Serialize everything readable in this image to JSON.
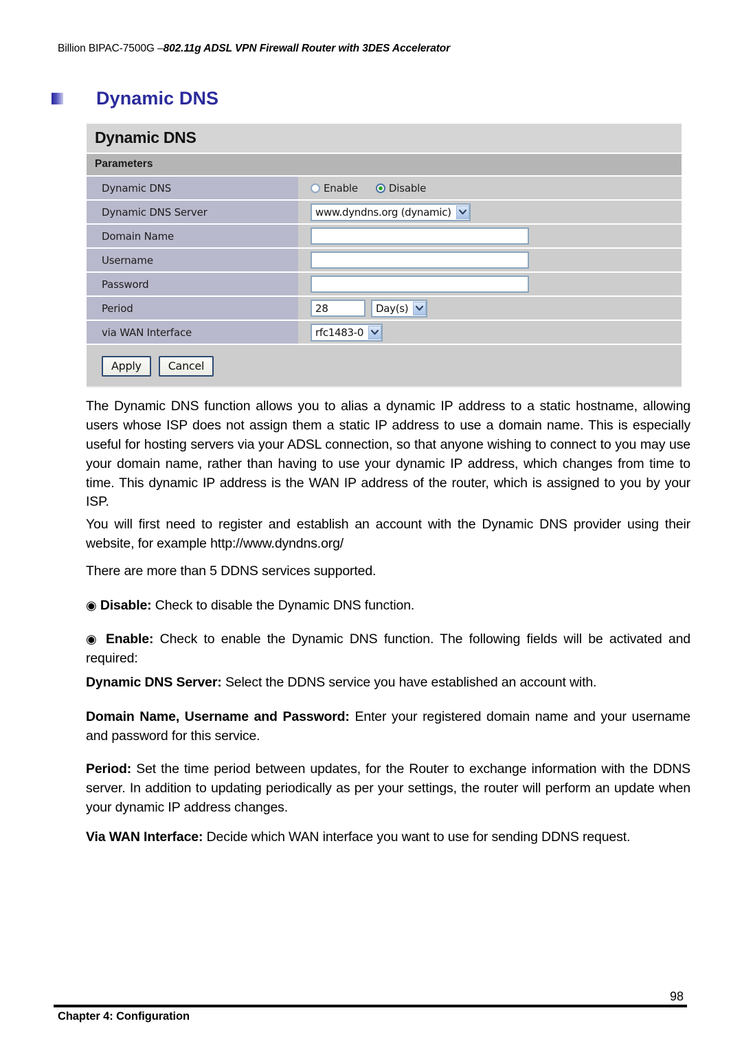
{
  "header": {
    "model": "Billion BIPAC-7500G –",
    "subtitle": "802.11g ADSL VPN Firewall Router with 3DES Accelerator"
  },
  "section": {
    "heading": "Dynamic DNS"
  },
  "panel": {
    "title": "Dynamic DNS",
    "subbar": "Parameters",
    "rows": {
      "dynamic_dns": {
        "label": "Dynamic DNS",
        "radio_enable": "Enable",
        "radio_disable": "Disable",
        "selected": "Disable"
      },
      "dns_server": {
        "label": "Dynamic DNS Server",
        "value": "www.dyndns.org (dynamic)"
      },
      "domain_name": {
        "label": "Domain Name",
        "value": ""
      },
      "username": {
        "label": "Username",
        "value": ""
      },
      "password": {
        "label": "Password",
        "value": ""
      },
      "period": {
        "label": "Period",
        "value": "28",
        "unit": "Day(s)"
      },
      "wan_interface": {
        "label": "via WAN Interface",
        "value": "rfc1483-0"
      }
    },
    "buttons": {
      "apply": "Apply",
      "cancel": "Cancel"
    }
  },
  "body": {
    "para1": "The Dynamic DNS function allows you to alias a dynamic IP address to a static hostname, allowing users whose ISP does not assign them a static IP address to use a domain name. This is especially useful for hosting servers via your ADSL connection, so that anyone wishing to connect to you may use your domain name, rather than having to use your dynamic IP address, which changes from time to time. This dynamic IP address is the WAN IP address of the router, which is assigned to you by your ISP.",
    "para2": "You will first need to register and establish an account with the Dynamic DNS provider using their website, for example http://www.dyndns.org/",
    "para3": "There are more than 5 DDNS services supported.",
    "bullet_glyph": "◉",
    "disable_term": "Disable:",
    "disable_desc": "Check to disable the Dynamic DNS function.",
    "enable_term": "Enable:",
    "enable_desc": "Check to enable the Dynamic DNS function. The following fields will be activated and required:",
    "dns_server_term": "Dynamic DNS Server:",
    "dns_server_desc": "Select the DDNS service you have established an account with.",
    "credentials_term": "Domain Name, Username and Password:",
    "credentials_desc": "Enter your registered domain name and your username and password for this service.",
    "period_term": "Period:",
    "period_desc": "Set the time period between updates, for the Router to exchange information with the DDNS server. In addition to updating periodically as per your settings, the router will perform an update when your dynamic IP address changes.",
    "wan_term": "Via WAN Interface:",
    "wan_desc": "Decide which WAN interface you want to use for sending DDNS request."
  },
  "footer": {
    "chapter": "Chapter 4: Configuration",
    "page": "98"
  }
}
